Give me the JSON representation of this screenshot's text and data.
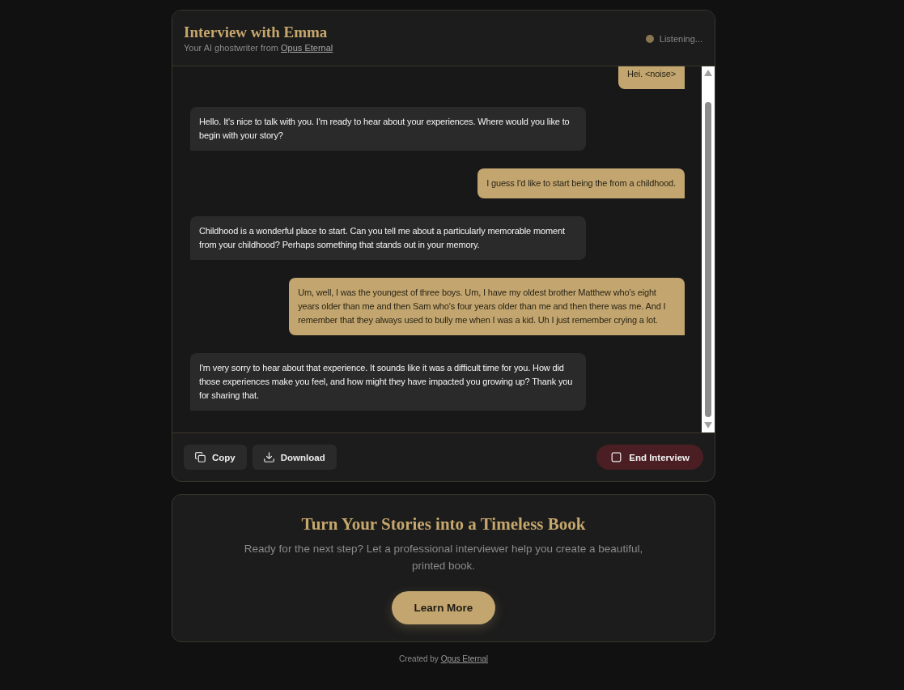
{
  "header": {
    "title": "Interview with Emma",
    "subtitle": "Your AI ghostwriter from",
    "subtitle_link": "Opus Eternal",
    "status": "Listening..."
  },
  "messages": [
    {
      "kind": "user",
      "text": "Hei. <noise>"
    },
    {
      "kind": "assistant",
      "text": "Hello. It's nice to talk with you. I'm ready to hear about your experiences. Where would you like to begin with your story?"
    },
    {
      "kind": "user",
      "text": "I guess I'd like to start being the from a childhood."
    },
    {
      "kind": "assistant",
      "text": "Childhood is a wonderful place to start. Can you tell me about a particularly memorable moment from your childhood? Perhaps something that stands out in your memory."
    },
    {
      "kind": "user",
      "text": "Um, well, I was the youngest of three boys. Um, I have my oldest brother Matthew who's eight years older than me and then Sam who's four years older than me and then there was me. And I remember that they always used to bully me when I was a kid. Uh I just remember crying a lot."
    },
    {
      "kind": "assistant",
      "text": "I'm very sorry to hear about that experience. It sounds like it was a difficult time for you. How did those experiences make you feel, and how might they have impacted you growing up? Thank you for sharing that."
    }
  ],
  "actions": [
    {
      "kind": "copy",
      "label": "Copy"
    },
    {
      "kind": "download",
      "label": "Download"
    }
  ],
  "end_button": {
    "label": "End Interview"
  },
  "promo": {
    "title": "Turn Your Stories into a Timeless Book",
    "text": "Ready for the next step? Let a professional interviewer help you create a beautiful, printed book.",
    "button": "Learn More"
  },
  "footer": {
    "text": "Created by",
    "link": "Opus Eternal"
  }
}
